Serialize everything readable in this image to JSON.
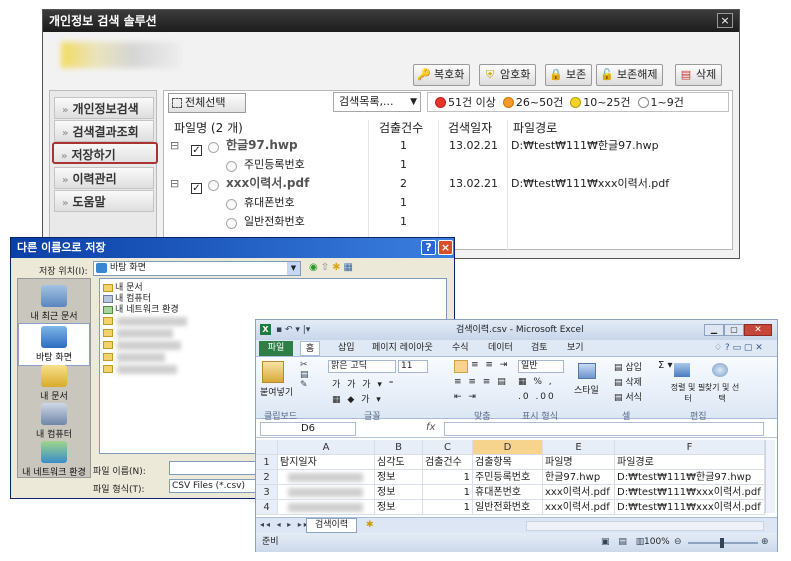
{
  "app": {
    "title": "개인정보 검색 솔루션",
    "close": "×",
    "toolbar": {
      "decrypt": "복호화",
      "encrypt": "암호화",
      "protect": "보존",
      "unprotect": "보존해제",
      "delete": "삭제"
    },
    "sidebar": {
      "items": [
        {
          "label": "개인정보검색"
        },
        {
          "label": "검색결과조회"
        },
        {
          "label": "저장하기"
        },
        {
          "label": "이력관리"
        },
        {
          "label": "도움말"
        }
      ],
      "chevron": "»"
    },
    "list": {
      "select_all": "전체선택",
      "search_list": "검색목록,...",
      "legend": [
        {
          "label": "51건 이상",
          "color": "#e8342a"
        },
        {
          "label": "26~50건",
          "color": "#f39a2a"
        },
        {
          "label": "10~25건",
          "color": "#f4d32a"
        },
        {
          "label": "1~9건",
          "color": "#ffffff"
        }
      ],
      "headers": {
        "filename": "파일명 (2 개)",
        "count": "검출건수",
        "date": "검색일자",
        "path": "파일경로"
      },
      "rows": [
        {
          "kind": "file",
          "name": "한글97.hwp",
          "count": "1",
          "date": "13.02.21",
          "path": "D:₩test₩111₩한글97.hwp"
        },
        {
          "kind": "item",
          "name": "주민등록번호",
          "count": "1"
        },
        {
          "kind": "file",
          "name": "xxx이력서.pdf",
          "count": "2",
          "date": "13.02.21",
          "path": "D:₩test₩111₩xxx이력서.pdf"
        },
        {
          "kind": "item",
          "name": "휴대폰번호",
          "count": "1"
        },
        {
          "kind": "item",
          "name": "일반전화번호",
          "count": "1"
        }
      ]
    }
  },
  "dialog": {
    "title": "다른 이름으로 저장",
    "help": "?",
    "close": "×",
    "location_label": "저장 위치(I):",
    "location_value": "바탕 화면",
    "places": [
      "내 최근 문서",
      "바탕 화면",
      "내 문서",
      "내 컴퓨터",
      "내 네트워크 환경"
    ],
    "files": [
      "내 문서",
      "내 컴퓨터",
      "내 네트워크 환경"
    ],
    "filename_label": "파일 이름(N):",
    "filetype_label": "파일 형식(T):",
    "filetype_value": "CSV Files (*.csv)"
  },
  "excel": {
    "title": "검색이력.csv - Microsoft Excel",
    "tabs": [
      "파일",
      "홈",
      "삽입",
      "페이지 레이아웃",
      "수식",
      "데이터",
      "검토",
      "보기"
    ],
    "ribbon": {
      "paste": "붙여넣기",
      "font_name": "맑은 고딕",
      "font_size": "11",
      "number_format": "일반",
      "style": "스타일",
      "insert": "삽입",
      "delete": "삭제",
      "format": "서식",
      "sort_filter": "정렬 및 필터",
      "find_select": "찾기 및 선택",
      "groups": [
        "클립보드",
        "글꼴",
        "맞춤",
        "표시 형식",
        "셀",
        "편집"
      ]
    },
    "name_box": "D6",
    "fx": "fx",
    "columns": [
      "A",
      "B",
      "C",
      "D",
      "E",
      "F"
    ],
    "rows": [
      [
        "1",
        "탐지일자",
        "심각도",
        "검출건수",
        "검출항목",
        "파일명",
        "파일경로"
      ],
      [
        "2",
        "",
        "정보",
        "1",
        "주민등록번호",
        "한글97.hwp",
        "D:₩test₩111₩한글97.hwp"
      ],
      [
        "3",
        "",
        "정보",
        "1",
        "휴대폰번호",
        "xxx이력서.pdf",
        "D:₩test₩111₩xxx이력서.pdf"
      ],
      [
        "4",
        "",
        "정보",
        "1",
        "일반전화번호",
        "xxx이력서.pdf",
        "D:₩test₩111₩xxx이력서.pdf"
      ]
    ],
    "sheet_tab": "검색이력",
    "status_ready": "준비",
    "zoom": "100%"
  }
}
